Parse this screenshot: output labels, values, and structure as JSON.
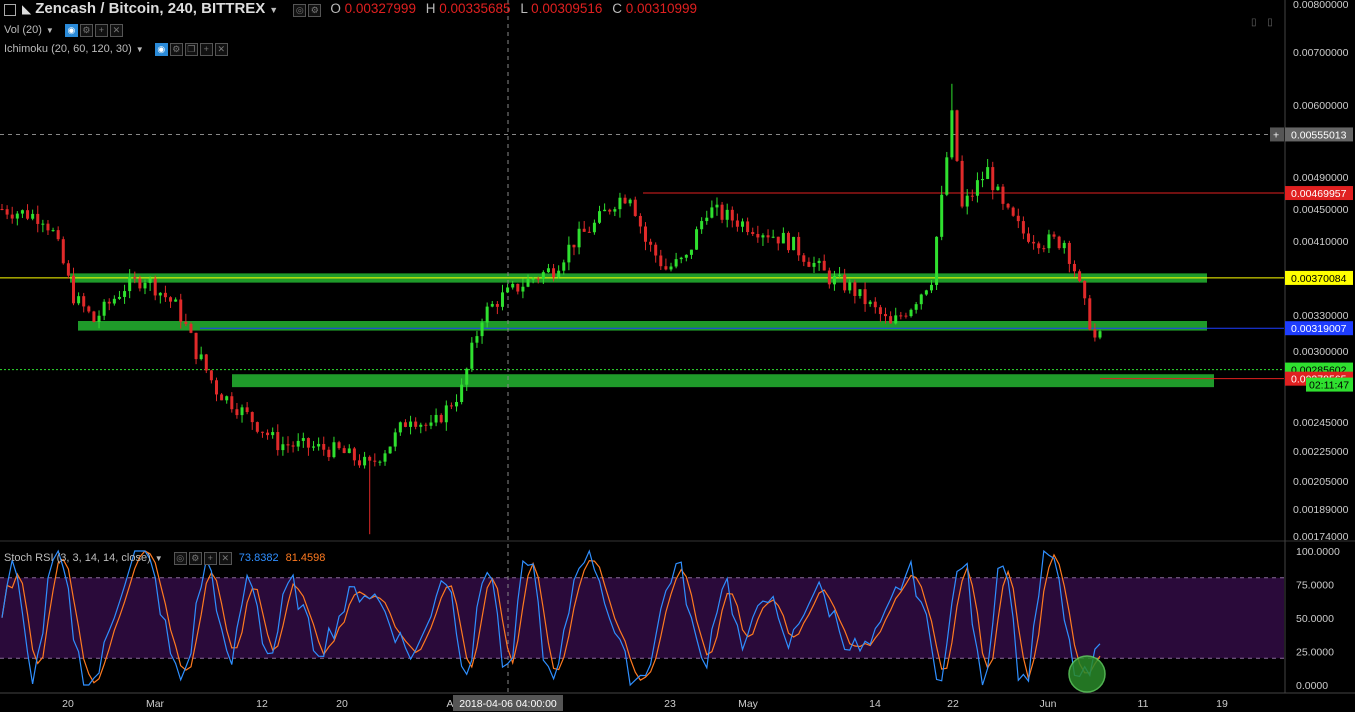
{
  "header": {
    "symbol": "Zencash / Bitcoin, 240, BITTREX",
    "o_label": "O",
    "o_value": "0.00327999",
    "h_label": "H",
    "h_value": "0.00335685",
    "l_label": "L",
    "l_value": "0.00309516",
    "c_label": "C",
    "c_value": "0.00310999"
  },
  "indicators": {
    "volume": "Vol (20)",
    "ichimoku": "Ichimoku (20, 60, 120, 30)",
    "stoch_rsi": "Stoch RSI (3, 3, 14, 14, close)",
    "stoch_k_value": "73.8382",
    "stoch_d_value": "81.4598"
  },
  "crosshair": {
    "date_label": "2018-04-06 04:00:00",
    "price_label": "0.00555013"
  },
  "colors": {
    "up": "#2fe02f",
    "down": "#e02a2a",
    "zone": "#1f9a2a",
    "stoch_k": "#2f8fff",
    "stoch_d": "#ff7a20",
    "stoch_band": "#2a0a3a",
    "yellow_line": "#ffff00",
    "blue_line": "#1e3dff",
    "red_line": "#e02020"
  },
  "chart_data": {
    "type": "candlestick",
    "ylim": [
      0.00174,
      0.008
    ],
    "y_tick_labels": [
      "0.00800000",
      "0.00700000",
      "0.00600000",
      "0.00490000",
      "0.00450000",
      "0.00410000",
      "0.00330000",
      "0.00300000",
      "0.00245000",
      "0.00225000",
      "0.00205000",
      "0.00189000",
      "0.00174000"
    ],
    "x_tick_labels": [
      "20",
      "Mar",
      "12",
      "20",
      "A",
      "23",
      "May",
      "14",
      "22",
      "Jun",
      "11",
      "19"
    ],
    "close_path": [
      [
        0,
        0.0045
      ],
      [
        8,
        0.0044
      ],
      [
        10,
        0.0042
      ],
      [
        14,
        0.0035
      ],
      [
        18,
        0.00325
      ],
      [
        24,
        0.0036
      ],
      [
        28,
        0.0037
      ],
      [
        30,
        0.0036
      ],
      [
        34,
        0.0034
      ],
      [
        38,
        0.003
      ],
      [
        42,
        0.0027
      ],
      [
        48,
        0.0025
      ],
      [
        54,
        0.0023
      ],
      [
        60,
        0.00228
      ],
      [
        66,
        0.00225
      ],
      [
        72,
        0.00215
      ],
      [
        76,
        0.0023
      ],
      [
        80,
        0.0025
      ],
      [
        84,
        0.0024
      ],
      [
        90,
        0.0027
      ],
      [
        94,
        0.0033
      ],
      [
        98,
        0.0035
      ],
      [
        104,
        0.0037
      ],
      [
        108,
        0.0038
      ],
      [
        112,
        0.0041
      ],
      [
        116,
        0.0043
      ],
      [
        120,
        0.0046
      ],
      [
        123,
        0.0047
      ],
      [
        126,
        0.0041
      ],
      [
        130,
        0.0038
      ],
      [
        134,
        0.0039
      ],
      [
        138,
        0.0045
      ],
      [
        142,
        0.0044
      ],
      [
        146,
        0.0043
      ],
      [
        150,
        0.0042
      ],
      [
        154,
        0.0041
      ],
      [
        158,
        0.0039
      ],
      [
        162,
        0.0037
      ],
      [
        166,
        0.0036
      ],
      [
        170,
        0.0034
      ],
      [
        174,
        0.0032
      ],
      [
        178,
        0.0034
      ],
      [
        182,
        0.0037
      ],
      [
        184,
        0.0046
      ],
      [
        186,
        0.0058
      ],
      [
        188,
        0.0045
      ],
      [
        190,
        0.0047
      ],
      [
        193,
        0.005
      ],
      [
        196,
        0.0045
      ],
      [
        200,
        0.0042
      ],
      [
        204,
        0.0041
      ],
      [
        208,
        0.0041
      ],
      [
        210,
        0.0038
      ],
      [
        212,
        0.0034
      ],
      [
        214,
        0.0031
      ]
    ],
    "levels": [
      {
        "name": "",
        "price": 0.00469957,
        "label": "0.00469957",
        "color": "#e02020"
      },
      {
        "name": "",
        "price": 0.00370084,
        "label": "0.00370084",
        "color": "#ffff00"
      },
      {
        "name": "",
        "price": 0.00319007,
        "label": "0.00319007",
        "color": "#1e3dff"
      },
      {
        "name": "",
        "price": 0.00285602,
        "label": "0.00285602",
        "color": "#2fe02f"
      },
      {
        "name": "",
        "price": 0.00278565,
        "label": "0.00278565",
        "color": "#e02020"
      }
    ],
    "current_countdown": "02:11:47",
    "zones": [
      {
        "low": 0.00365,
        "high": 0.00375
      },
      {
        "low": 0.00317,
        "high": 0.00325
      },
      {
        "low": 0.00272,
        "high": 0.00282
      }
    ],
    "stoch_ticks": [
      "100.0000",
      "75.0000",
      "50.0000",
      "25.0000",
      "0.0000"
    ],
    "stoch_band": [
      20,
      80
    ]
  }
}
